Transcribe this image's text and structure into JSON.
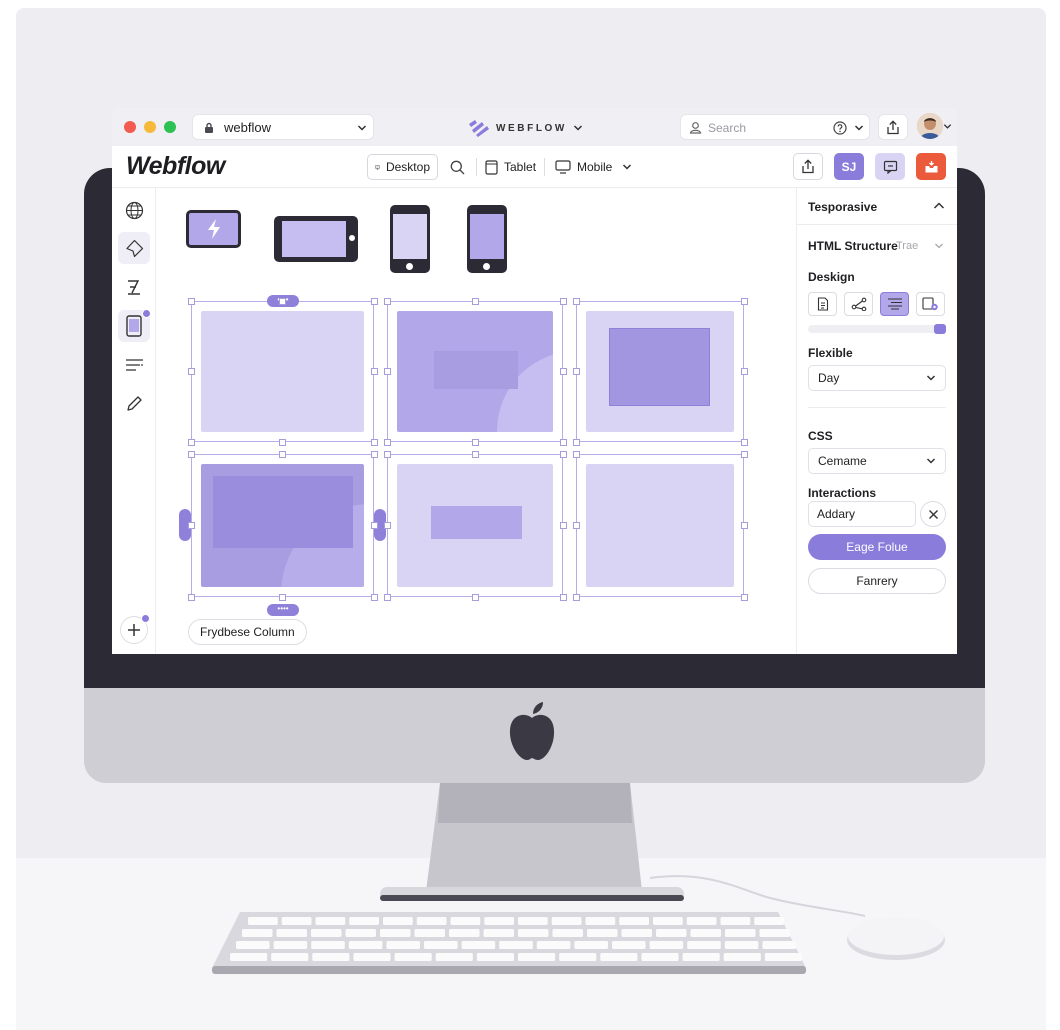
{
  "browser": {
    "url_text": "webflow",
    "brand_text": "WEBFLOW",
    "search_placeholder": "Search"
  },
  "topbar": {
    "logo": "Webflow",
    "viewports": {
      "desktop": "Desktop",
      "tablet": "Tablet",
      "mobile": "Mobile"
    },
    "publish_label": "SJ"
  },
  "canvas": {
    "column_label": "Frydbese Column",
    "handle_dots": "••••"
  },
  "panel": {
    "header": "Tesporasive",
    "html_structure": {
      "label": "HTML Structure",
      "value": "Trae"
    },
    "design_label": "Deskign",
    "flexible": {
      "label": "Flexible",
      "value": "Day"
    },
    "css": {
      "label": "CSS",
      "value": "Cemame"
    },
    "interactions": {
      "label": "Interactions",
      "field_value": "Addary"
    },
    "primary_button": "Eage Folue",
    "secondary_button": "Fanrery"
  },
  "colors": {
    "accent": "#8a7cdb",
    "accent_light": "#d9d4f3",
    "accent_mid": "#b2a7e9",
    "danger": "#ec5a3c",
    "traffic_red": "#f25b4f",
    "traffic_yellow": "#f6b93b",
    "traffic_green": "#2cc152"
  },
  "icons": [
    "lock-icon",
    "webflow-logo-icon",
    "chevron-down-icon",
    "user-icon",
    "help-icon",
    "share-icon",
    "avatar",
    "desktop-icon",
    "search-icon",
    "tablet-icon",
    "mobile-icon",
    "export-icon",
    "comment-icon",
    "inbox-icon",
    "globe-icon",
    "navigator-icon",
    "typography-icon",
    "device-icon",
    "text-align-icon",
    "pen-icon",
    "plus-icon",
    "close-icon",
    "apple-logo-icon"
  ]
}
